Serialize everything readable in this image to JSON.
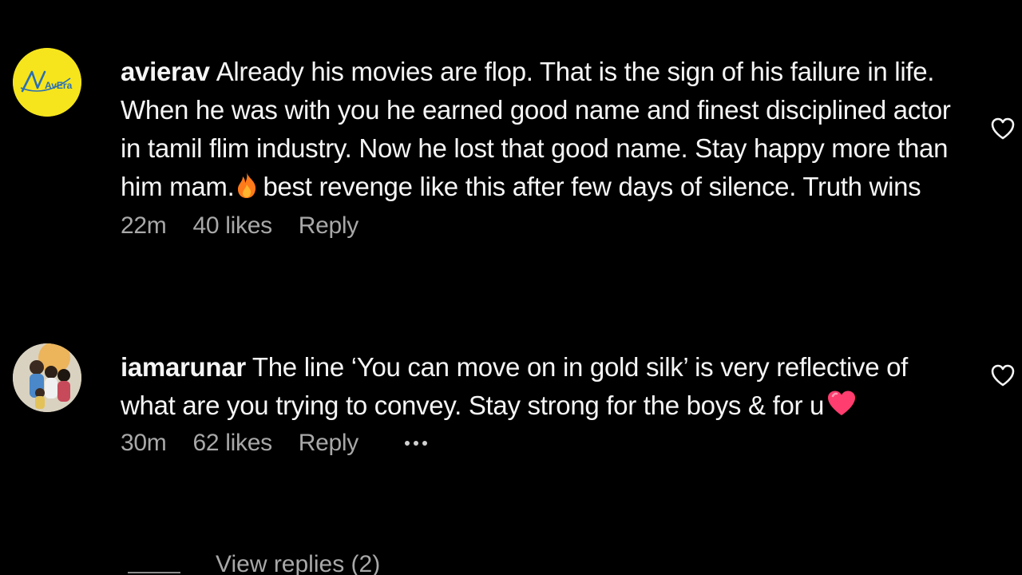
{
  "comments": [
    {
      "username": "avierav",
      "avatar_label": "AvEra",
      "text_before": "Already his movies are flop. That is the sign of his failure in life. When he was with you he earned good name and finest disciplined actor in tamil flim industry. Now he lost that good name. Stay happy more than him mam.",
      "emoji": "fire-emoji",
      "text_after": "best revenge like this after few days of silence. Truth wins",
      "time": "22m",
      "likes": "40 likes",
      "reply_label": "Reply"
    },
    {
      "username": "iamarunar",
      "avatar_label": "",
      "text_before": "The line ‘You can move on in gold silk’ is very reflective of what are you trying to convey. Stay strong for the boys & for u",
      "emoji": "heart-emoji",
      "text_after": "",
      "time": "30m",
      "likes": "62 likes",
      "reply_label": "Reply"
    }
  ],
  "view_replies_label": "View replies (2)",
  "colors": {
    "background": "#000000",
    "text": "#f5f5f5",
    "muted": "#a8a8a8",
    "avatar_yellow": "#f6e51c",
    "fire": "#ff7a1a",
    "heart_emoji": "#ff3d6e"
  }
}
